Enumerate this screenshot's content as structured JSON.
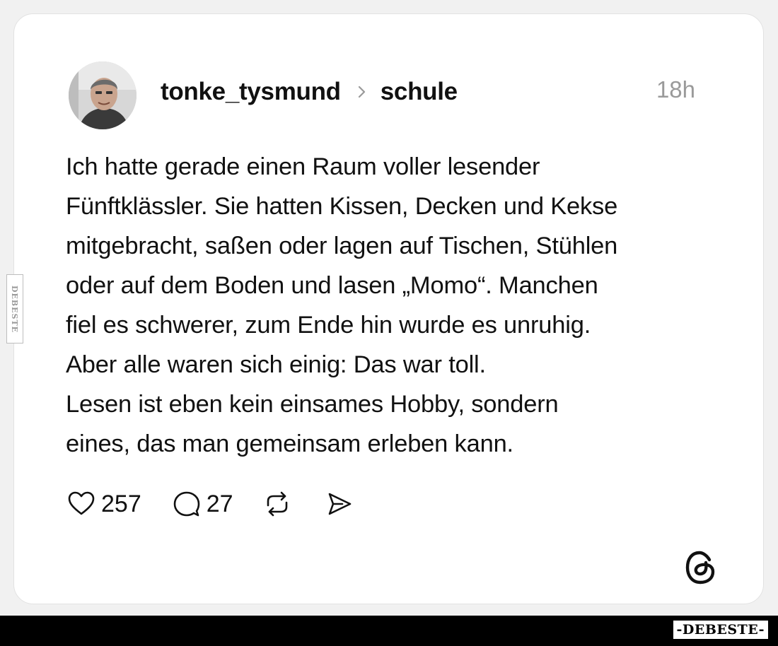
{
  "post": {
    "username": "tonke_tysmund",
    "topic": "schule",
    "time": "18h",
    "text_lines": [
      "Ich hatte gerade einen Raum voller lesender",
      "Fünftklässler. Sie hatten Kissen, Decken und Kekse",
      "mitgebracht, saßen oder lagen auf Tischen, Stühlen",
      "oder auf dem Boden und lasen „Momo“. Manchen",
      "fiel es schwerer, zum Ende hin wurde es unruhig.",
      "Aber alle waren sich einig: Das war toll.",
      "Lesen ist eben kein einsames Hobby, sondern",
      "eines, das man gemeinsam erleben kann."
    ],
    "likes": "257",
    "replies": "27"
  },
  "icons": {
    "avatar": "avatar-photo",
    "breadcrumb": "chevron-right-icon",
    "like": "heart-icon",
    "reply": "comment-bubble-icon",
    "repost": "repost-icon",
    "share": "send-icon",
    "brand": "threads-logo-icon"
  },
  "watermark": {
    "side": "DEBESTE",
    "bottom": "-DEBESTE-"
  },
  "colors": {
    "text": "#111111",
    "muted": "#9a9a9a",
    "card": "#ffffff",
    "background": "#f1f1f1",
    "footer_bar": "#000000"
  }
}
